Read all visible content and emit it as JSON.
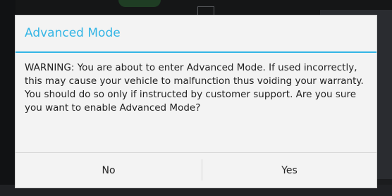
{
  "dialog": {
    "title": "Advanced Mode",
    "message": "WARNING: You are about to enter Advanced Mode. If used incorrectly, this may cause your vehicle to malfunction thus voiding your warranty. You should do so only if instructed by customer support. Are you sure you want to enable Advanced Mode?",
    "negative_label": "No",
    "positive_label": "Yes"
  },
  "colors": {
    "accent": "#33b5e5",
    "dialog_background": "#f3f3f3",
    "text": "#222222"
  }
}
